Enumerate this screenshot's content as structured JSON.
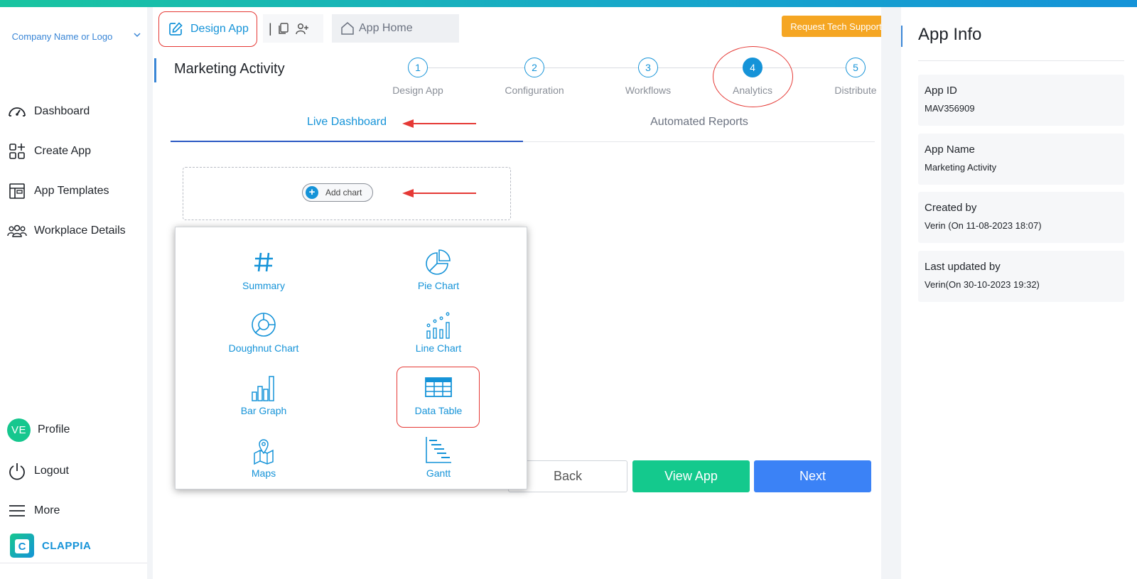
{
  "sidebar": {
    "company": "Company Name or Logo",
    "items": [
      {
        "label": "Dashboard",
        "icon": "gauge-icon"
      },
      {
        "label": "Create App",
        "icon": "create-app-icon"
      },
      {
        "label": "App Templates",
        "icon": "templates-icon"
      },
      {
        "label": "Workplace Details",
        "icon": "people-icon"
      }
    ],
    "profile": {
      "initials": "VE",
      "label": "Profile"
    },
    "logout": "Logout",
    "more": "More",
    "brand": "CLAPPIA"
  },
  "header": {
    "design_app_tab": "Design App",
    "separator": "|",
    "app_home_tab": "App Home",
    "support_button": "Request Tech Support"
  },
  "page": {
    "title": "Marketing Activity"
  },
  "steps": [
    {
      "num": "1",
      "label": "Design App"
    },
    {
      "num": "2",
      "label": "Configuration"
    },
    {
      "num": "3",
      "label": "Workflows"
    },
    {
      "num": "4",
      "label": "Analytics",
      "active": true
    },
    {
      "num": "5",
      "label": "Distribute"
    }
  ],
  "subtabs": {
    "live": "Live Dashboard",
    "automated": "Automated Reports"
  },
  "add_chart": {
    "plus": "+",
    "label": "Add chart"
  },
  "chart_types": [
    {
      "label": "Summary",
      "icon": "hash-icon"
    },
    {
      "label": "Pie Chart",
      "icon": "pie-chart-icon"
    },
    {
      "label": "Doughnut Chart",
      "icon": "doughnut-chart-icon"
    },
    {
      "label": "Line Chart",
      "icon": "line-chart-icon"
    },
    {
      "label": "Bar Graph",
      "icon": "bar-graph-icon"
    },
    {
      "label": "Data Table",
      "icon": "data-table-icon"
    },
    {
      "label": "Maps",
      "icon": "map-icon"
    },
    {
      "label": "Gantt",
      "icon": "gantt-icon"
    }
  ],
  "buttons": {
    "back": "Back",
    "view_app": "View App",
    "next": "Next"
  },
  "app_info": {
    "title": "App Info",
    "fields": [
      {
        "key": "App ID",
        "value": "MAV356909"
      },
      {
        "key": "App Name",
        "value": "Marketing Activity"
      },
      {
        "key": "Created by",
        "value": "Verin (On 11-08-2023 18:07)"
      },
      {
        "key": "Last updated by",
        "value": "Verin(On 30-10-2023 19:32)"
      }
    ]
  },
  "colors": {
    "accent": "#1593d8",
    "highlight": "#e53935",
    "view_app": "#14c98d",
    "next": "#3b82f6",
    "support": "#f5a623"
  }
}
